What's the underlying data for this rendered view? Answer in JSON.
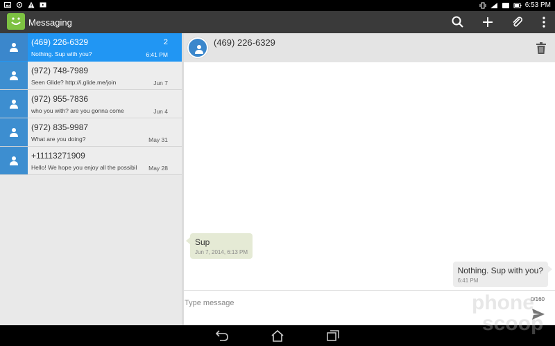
{
  "status_bar": {
    "time": "6:53 PM"
  },
  "app": {
    "title": "Messaging"
  },
  "conversations": [
    {
      "name": "(469) 226-6329",
      "preview": "Nothing. Sup with you?",
      "date": "6:41 PM",
      "count": "2"
    },
    {
      "name": "(972) 748-7989",
      "preview": "Seen Glide? http://i.glide.me/join",
      "date": "Jun 7"
    },
    {
      "name": "(972) 955-7836",
      "preview": "who you with? are you gonna come",
      "date": "Jun 4"
    },
    {
      "name": "(972) 835-9987",
      "preview": "What are you doing?",
      "date": "May 31"
    },
    {
      "name": "+11113271909",
      "preview": "Hello! We hope you enjoy all the possibil",
      "date": "May 28"
    }
  ],
  "thread": {
    "title": "(469) 226-6329",
    "messages": [
      {
        "text": "Sup",
        "time": "Jun 7, 2014, 6:13 PM",
        "direction": "incoming"
      },
      {
        "text": "Nothing. Sup with you?",
        "time": "6:41 PM",
        "direction": "outgoing"
      }
    ]
  },
  "compose": {
    "placeholder": "Type message",
    "char_count": "0/160"
  },
  "colors": {
    "accent": "#2196f3",
    "action_bar": "#3a3a3a",
    "logo": "#7dc242"
  }
}
